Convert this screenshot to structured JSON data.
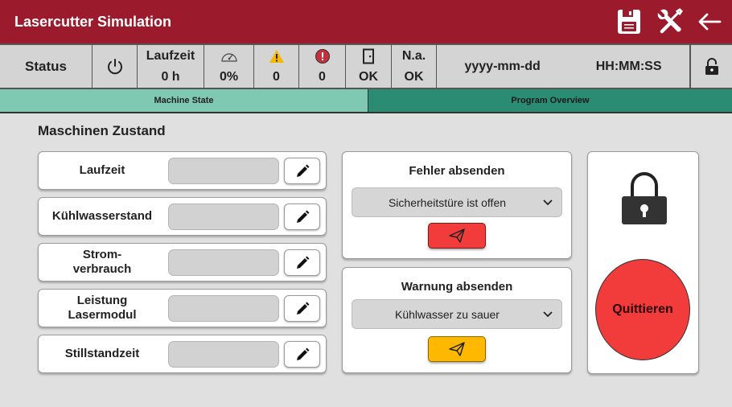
{
  "app": {
    "title": "Lasercutter Simulation"
  },
  "header_icons": [
    "save-icon",
    "tools-icon",
    "back-arrow-icon"
  ],
  "status": {
    "label": "Status",
    "laufzeit_label": "Laufzeit",
    "laufzeit_value": "0 h",
    "speed_value": "0%",
    "warnings_value": "0",
    "errors_value": "0",
    "door_value": "OK",
    "na_label": "N.a.",
    "na_value": "OK",
    "date": "yyyy-mm-dd",
    "time": "HH:MM:SS"
  },
  "tabs": [
    {
      "label": "Machine State",
      "active": true
    },
    {
      "label": "Program Overview",
      "active": false
    }
  ],
  "main": {
    "title": "Maschinen Zustand",
    "params": [
      {
        "label": "Laufzeit",
        "value": ""
      },
      {
        "label": "Kühlwasserstand",
        "value": ""
      },
      {
        "label": "Strom-\nverbrauch",
        "value": ""
      },
      {
        "label": "Leistung\nLasermodul",
        "value": ""
      },
      {
        "label": "Stillstandzeit",
        "value": ""
      }
    ],
    "error_card": {
      "title": "Fehler absenden",
      "selected": "Sicherheitstüre ist offen"
    },
    "warning_card": {
      "title": "Warnung absenden",
      "selected": "Kühlwasser zu sauer"
    },
    "quit_label": "Quittieren"
  },
  "colors": {
    "header": "#9b1a2c",
    "tab_active": "#7fc8b2",
    "tab_inactive": "#2a8c72",
    "error_send": "#f23b3b",
    "warning_send": "#ffb800",
    "quit": "#f23b3b",
    "warning_icon": "#f5b800",
    "error_icon": "#c4303b"
  }
}
